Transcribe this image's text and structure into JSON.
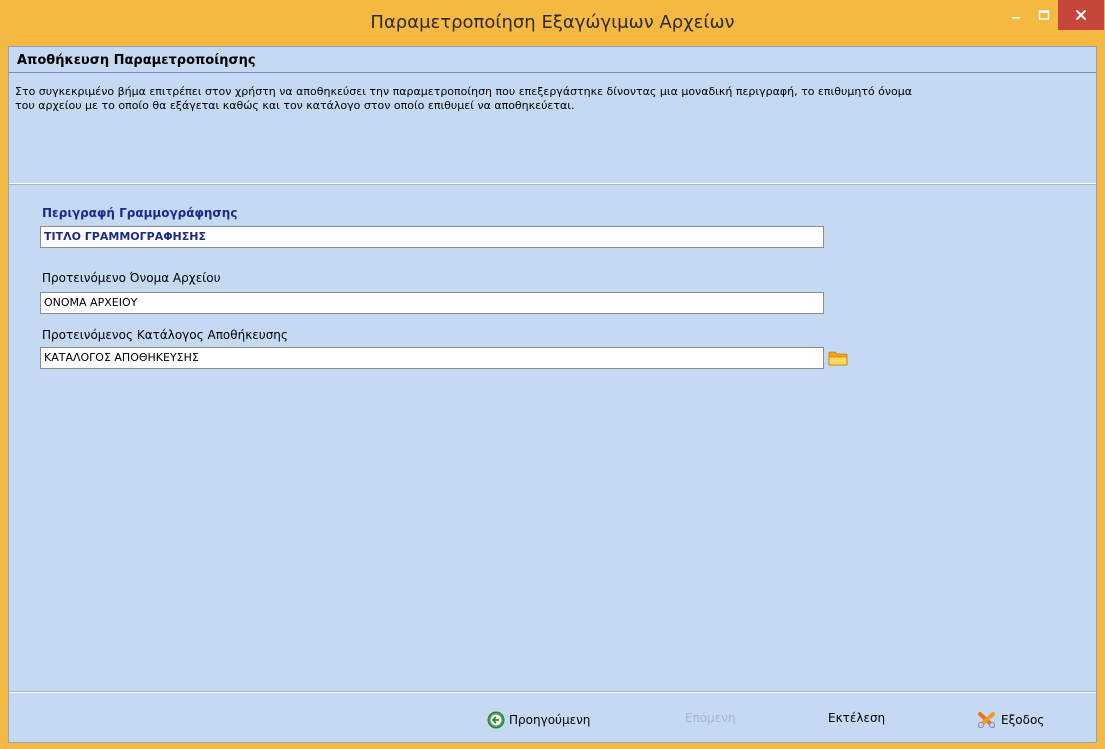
{
  "window": {
    "title": "Παραμετροποίηση Εξαγώγιμων Αρχείων",
    "minimize_icon": "minimize-icon",
    "maximize_icon": "maximize-icon",
    "close_icon": "close-icon"
  },
  "header": {
    "title": "Αποθήκευση Παραμετροποίησης",
    "description_line1": "Στο συγκεκριμένο βήμα επιτρέπει στον χρήστη να αποθηκεύσει την παραμετροποίηση που επεξεργάστηκε δίνοντας μια μοναδική περιγραφή, το επιθυμητό όνομα",
    "description_line2": "του αρχείου με το οποίο θα εξάγεται καθώς και τον κατάλογο στον οποίο επιθυμεί να αποθηκεύεται."
  },
  "form": {
    "description_label": "Περιγραφή Γραμμογράφησης",
    "description_value": "ΤΙΤΛΟ ΓΡΑΜΜΟΓΡΑΦΗΣΗΣ",
    "filename_label": "Προτεινόμενο Όνομα Αρχείου",
    "filename_value": "ΟΝΟΜΑ ΑΡΧΕΙΟΥ",
    "folder_label": "Προτεινόμενος Κατάλογος Αποθήκευσης",
    "folder_value": "ΚΑΤΑΛΟΓΟΣ ΑΠΟΘΗΚΕΥΣΗΣ",
    "folder_icon": "folder-icon"
  },
  "footer": {
    "previous_label": "Προηγούμενη",
    "next_label": "Επόμενη",
    "execute_label": "Εκτέλεση",
    "exit_label": "Εξοδος"
  },
  "colors": {
    "title_bar": "#f5b941",
    "client_bg": "#c5d9f3",
    "close_button": "#c7463b",
    "label_accent": "#1c2a8c"
  }
}
